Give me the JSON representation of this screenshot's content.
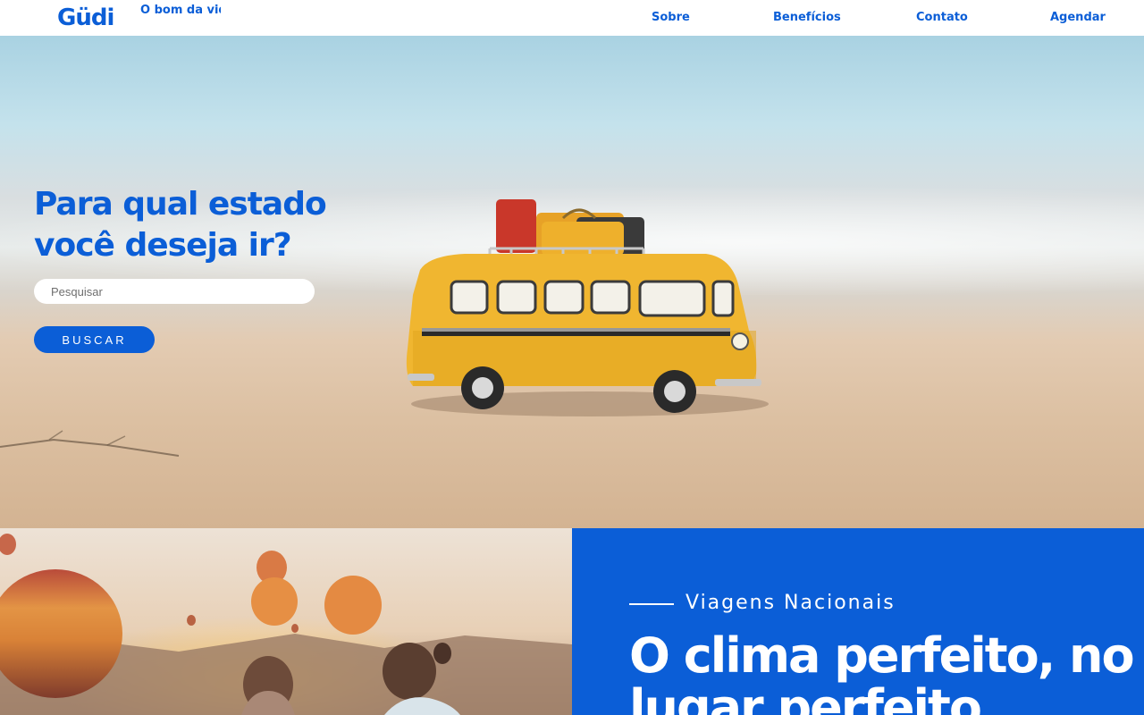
{
  "brand": {
    "logo": "Güdi",
    "tagline": "O bom da vida é viver"
  },
  "nav": {
    "items": [
      {
        "label": "Sobre"
      },
      {
        "label": "Benefícios"
      },
      {
        "label": "Contato"
      },
      {
        "label": "Agendar"
      }
    ]
  },
  "hero": {
    "title": "Para qual estado você deseja ir?",
    "search_placeholder": "Pesquisar",
    "search_button": "BUSCAR",
    "image": "toy-yellow-bus-on-beach"
  },
  "section2": {
    "image": "hot-air-balloons-couple-sunset",
    "kicker": "Viagens Nacionais",
    "headline": "O clima perfeito, no lugar perfeito"
  },
  "colors": {
    "brand_blue": "#0b5ed7",
    "white": "#ffffff"
  }
}
